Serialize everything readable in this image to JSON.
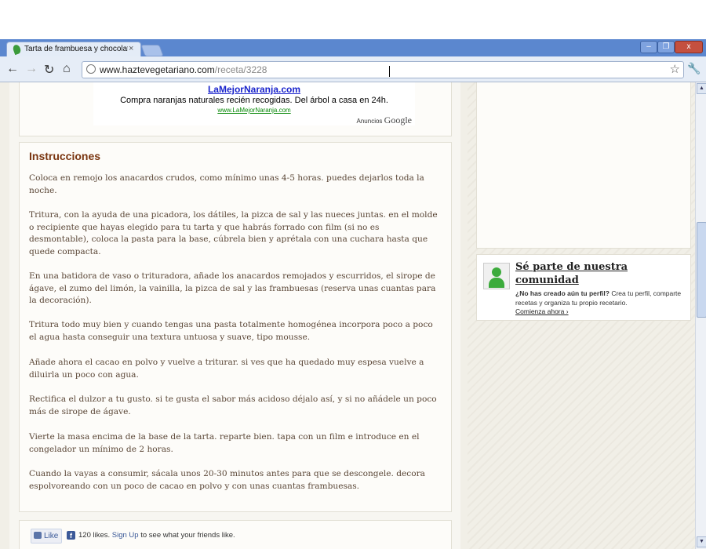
{
  "browser": {
    "tab_title": "Tarta de frambuesa y chocolat",
    "close_glyph": "×",
    "url_domain": "www.haztevegetariano.com",
    "url_path": "/receta/3228",
    "nav": {
      "back": "←",
      "forward": "→",
      "reload": "↻",
      "home": "⌂",
      "star": "☆",
      "wrench": "🔧"
    },
    "window": {
      "minimize": "–",
      "maximize": "❐",
      "close": "x"
    }
  },
  "ad": {
    "title": "LaMejorNaranja.com",
    "description": "Compra naranjas naturales recién recogidas. Del árbol a casa en 24h.",
    "link": "www.LaMejorNaranja.com",
    "by_label": "Anuncios",
    "by_brand": "Google"
  },
  "instructions": {
    "heading": "Instrucciones",
    "steps": [
      "Coloca en remojo los anacardos crudos, como mínimo unas 4-5 horas. puedes dejarlos toda la noche.",
      "Tritura, con la ayuda de una picadora, los dátiles, la pizca de sal y las nueces juntas. en el molde o recipiente que hayas elegido para tu tarta y que habrás forrado con film (si no es desmontable), coloca la pasta para la base, cúbrela bien y aprétala con una cuchara hasta que quede compacta.",
      "En una batidora de vaso o trituradora, añade los anacardos remojados y escurridos, el sirope de ágave, el zumo del limón, la vainilla, la pizca de sal y las frambuesas (reserva unas cuantas para la decoración).",
      "Tritura todo muy bien y cuando tengas una pasta totalmente homogénea incorpora poco a poco el agua hasta conseguir una textura untuosa y suave, tipo mousse.",
      "Añade ahora el cacao en polvo y vuelve a triturar. si ves que ha quedado muy espesa vuelve a diluirla un poco con agua.",
      "Rectifica el dulzor a tu gusto. si te gusta el sabor más acidoso déjalo así, y si no añádele un poco más de sirope de ágave.",
      "Vierte la masa encima de la base de la tarta. reparte bien. tapa con un film e introduce en el congelador un mínimo de 2 horas.",
      "Cuando la vayas a consumir, sácala unos 20-30 minutos antes para que se descongele. decora espolvoreando con un poco de cacao en polvo y con unas cuantas frambuesas."
    ]
  },
  "social": {
    "like_label": "Like",
    "fb_glyph": "f",
    "likes_count": "120 likes.",
    "signup_label": "Sign Up",
    "likes_suffix": " to see what your friends like."
  },
  "community": {
    "title": "Sé parte de nuestra comunidad",
    "question": "¿No has creado aún tu perfil?",
    "description": " Crea tu perfil, comparte recetas y organiza tu propio recetario.",
    "cta": "Comienza ahora ›"
  },
  "scrollbar": {
    "up": "▲",
    "down": "▼"
  },
  "colors": {
    "heading": "#7a3510",
    "body_text": "#5a4636",
    "tabstrip": "#5b87cf",
    "page_bg": "#f1efe7"
  }
}
